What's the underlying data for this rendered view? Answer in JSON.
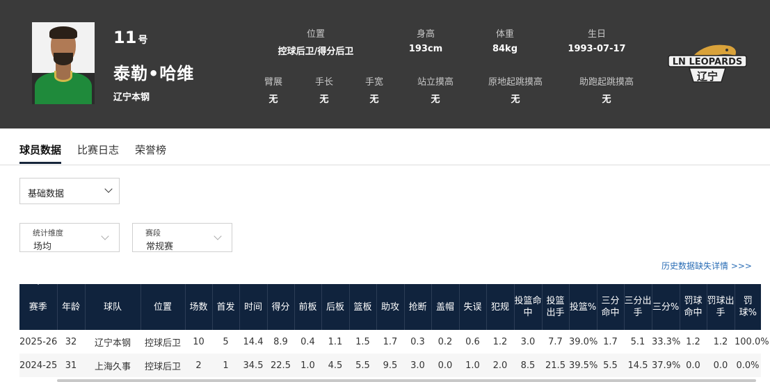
{
  "player": {
    "number": "11",
    "number_suffix": "号",
    "name": "泰勒•哈维",
    "team": "辽宁本钢"
  },
  "info_top": [
    {
      "label": "位置",
      "value": "控球后卫/得分后卫"
    },
    {
      "label": "身高",
      "value": "193cm"
    },
    {
      "label": "体重",
      "value": "84kg"
    },
    {
      "label": "生日",
      "value": "1993-07-17"
    }
  ],
  "info_bottom": [
    {
      "label": "臂展",
      "value": "无"
    },
    {
      "label": "手长",
      "value": "无"
    },
    {
      "label": "手宽",
      "value": "无"
    },
    {
      "label": "站立摸高",
      "value": "无"
    },
    {
      "label": "原地起跳摸高",
      "value": "无"
    },
    {
      "label": "助跑起跳摸高",
      "value": "无"
    }
  ],
  "logo": {
    "text": "LN LEOPARDS",
    "subtext": "辽宁",
    "icon": "leopard-logo-icon"
  },
  "tabs": [
    {
      "label": "球员数据",
      "active": true
    },
    {
      "label": "比赛日志",
      "active": false
    },
    {
      "label": "荣誉榜",
      "active": false
    }
  ],
  "data_type_select": {
    "value": "基础数据"
  },
  "filters": [
    {
      "label": "统计维度",
      "value": "场均"
    },
    {
      "label": "赛段",
      "value": "常规赛"
    }
  ],
  "history_link": "历史数据缺失详情 >>>",
  "table": {
    "headers": [
      "赛季",
      "年龄",
      "球队",
      "位置",
      "场数",
      "首发",
      "时间",
      "得分",
      "前板",
      "后板",
      "篮板",
      "助攻",
      "抢断",
      "盖帽",
      "失误",
      "犯规",
      "投篮命中",
      "投篮出手",
      "投篮%",
      "三分命中",
      "三分出手",
      "三分%",
      "罚球命中",
      "罚球出手",
      "罚球%"
    ],
    "rows": [
      [
        "2025-26",
        "32",
        "辽宁本钢",
        "控球后卫",
        "10",
        "5",
        "14.4",
        "8.9",
        "0.4",
        "1.1",
        "1.5",
        "1.7",
        "0.3",
        "0.2",
        "0.6",
        "1.2",
        "3.0",
        "7.7",
        "39.0%",
        "1.7",
        "5.1",
        "33.3%",
        "1.2",
        "1.2",
        "100.0%"
      ],
      [
        "2024-25",
        "31",
        "上海久事",
        "控球后卫",
        "2",
        "1",
        "34.5",
        "22.5",
        "1.0",
        "4.5",
        "5.5",
        "9.5",
        "3.0",
        "0.0",
        "1.0",
        "2.0",
        "8.5",
        "21.5",
        "39.5%",
        "5.5",
        "14.5",
        "37.9%",
        "0.0",
        "0.0",
        "0.0%"
      ]
    ]
  }
}
